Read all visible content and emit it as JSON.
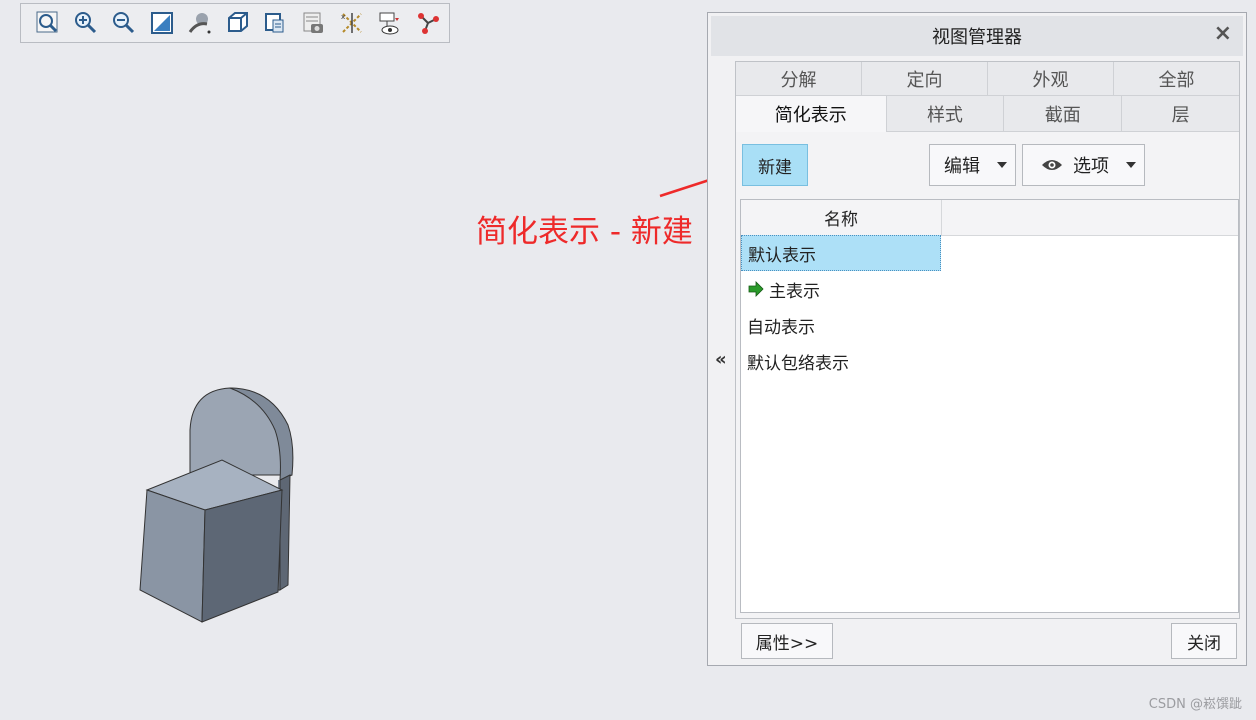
{
  "toolbar": {
    "buttons": [
      {
        "icon": "zoom-fit-icon"
      },
      {
        "icon": "zoom-in-icon"
      },
      {
        "icon": "zoom-out-icon"
      },
      {
        "icon": "repaint-icon"
      },
      {
        "icon": "spin-center-icon"
      },
      {
        "icon": "display-style-icon"
      },
      {
        "icon": "saved-orientations-icon"
      },
      {
        "icon": "view-manager-icon"
      },
      {
        "icon": "datum-display-icon"
      },
      {
        "icon": "annotation-display-icon"
      },
      {
        "icon": "spin-tool-icon"
      }
    ]
  },
  "annotation": {
    "text": "简化表示 - 新建",
    "color": "#ee2a2a"
  },
  "dialog": {
    "title": "视图管理器",
    "close_symbol": "×",
    "collapse_symbol": "«",
    "tabs_row1": [
      "分解",
      "定向",
      "外观",
      "全部"
    ],
    "tabs_row2": [
      "简化表示",
      "样式",
      "截面",
      "层"
    ],
    "active_tab": "简化表示",
    "new_button": "新建",
    "edit_dropdown": "编辑",
    "options_dropdown": "选项",
    "list": {
      "column_header": "名称",
      "rows": [
        {
          "label": "默认表示",
          "selected": true,
          "active": false
        },
        {
          "label": "主表示",
          "selected": false,
          "active": true
        },
        {
          "label": "自动表示",
          "selected": false,
          "active": false
        },
        {
          "label": "默认包络表示",
          "selected": false,
          "active": false
        }
      ]
    },
    "properties_button": "属性>>",
    "close_button": "关闭"
  },
  "watermark": "CSDN @崧馔跐",
  "colors": {
    "accent": "#a9dff6",
    "annotation": "#ee2a2a",
    "active_arrow": "#2a9a2a"
  }
}
